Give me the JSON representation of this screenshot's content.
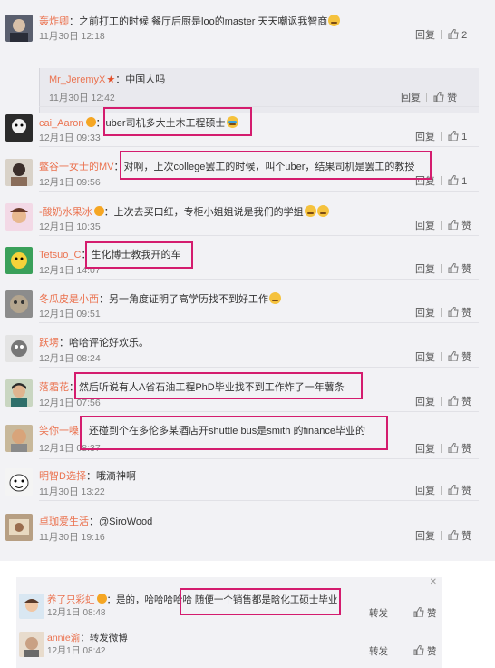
{
  "colors": {
    "username": "#eb7350",
    "highlight": "#d41c6e",
    "panel": "#f2f2f5"
  },
  "main_comments": [
    {
      "user": "轰炸卿",
      "badge": "",
      "content": "之前打工的时候 餐厅后厨是loo的master 天天嘲讽我智商",
      "emoji": "yellow",
      "time": "11月30日 12:18",
      "reply": "回复",
      "like": "2",
      "nested": {
        "user": "Mr_JeremyX",
        "content": "中国人吗",
        "time": "11月30日 12:42",
        "reply": "回复",
        "like": "赞"
      }
    },
    {
      "user": "cai_Aaron",
      "badge": "vip",
      "content": "uber司机多大土木工程硕士",
      "emoji": "blue",
      "time": "12月1日 09:33",
      "reply": "回复",
      "like": "1"
    },
    {
      "user": "鳖谷一女士的MV",
      "badge": "",
      "content": "对啊，上次college罢工的时候，叫个uber，结果司机是罢工的教授",
      "emoji": "",
      "time": "12月1日 09:56",
      "reply": "回复",
      "like": "1"
    },
    {
      "user": "-酸奶水果冰",
      "badge": "vip",
      "content": "上次去买口红，专柜小姐姐说是我们的学姐",
      "emoji": "double",
      "time": "12月1日 10:35",
      "reply": "回复",
      "like": "赞"
    },
    {
      "user": "Tetsuo_C",
      "badge": "",
      "content": "生化博士教我开的车",
      "emoji": "",
      "time": "12月1日 14:07",
      "reply": "回复",
      "like": "赞"
    },
    {
      "user": "冬瓜皮是小西",
      "badge": "",
      "content": "另一角度证明了高学历找不到好工作",
      "emoji": "yellow",
      "time": "12月1日 09:51",
      "reply": "回复",
      "like": "赞"
    },
    {
      "user": "跃塄",
      "badge": "",
      "content": "哈哈评论好欢乐。",
      "emoji": "",
      "time": "12月1日 08:24",
      "reply": "回复",
      "like": "赞"
    },
    {
      "user": "落霜花",
      "badge": "",
      "content": "然后听说有人A省石油工程PhD毕业找不到工作炸了一年薯条",
      "emoji": "",
      "time": "12月1日 07:56",
      "reply": "回复",
      "like": "赞"
    },
    {
      "user": "笑你一嗓",
      "badge": "",
      "content": "还碰到个在多伦多某酒店开shuttle bus是smith 的finance毕业的",
      "emoji": "",
      "time": "12月1日 08:37",
      "reply": "回复",
      "like": "赞"
    },
    {
      "user": "明智D选择",
      "badge": "",
      "content": "哦滴神啊",
      "emoji": "",
      "time": "11月30日 13:22",
      "reply": "回复",
      "like": "赞"
    },
    {
      "user": "卓珈爱生活",
      "badge": "",
      "content": "@SiroWood",
      "emoji": "",
      "time": "11月30日 19:16",
      "reply": "回复",
      "like": "赞"
    }
  ],
  "bottom_comments": [
    {
      "user": "养了只彩虹",
      "content": "是的，哈哈哈哈哈 随便一个销售都是晗化工硕士毕业",
      "time": "12月1日 08:48",
      "forward": "转发",
      "like": "赞"
    },
    {
      "user": "annie渝",
      "content": "转发微博",
      "time": "12月1日 08:42",
      "forward": "转发",
      "like": "赞"
    }
  ]
}
